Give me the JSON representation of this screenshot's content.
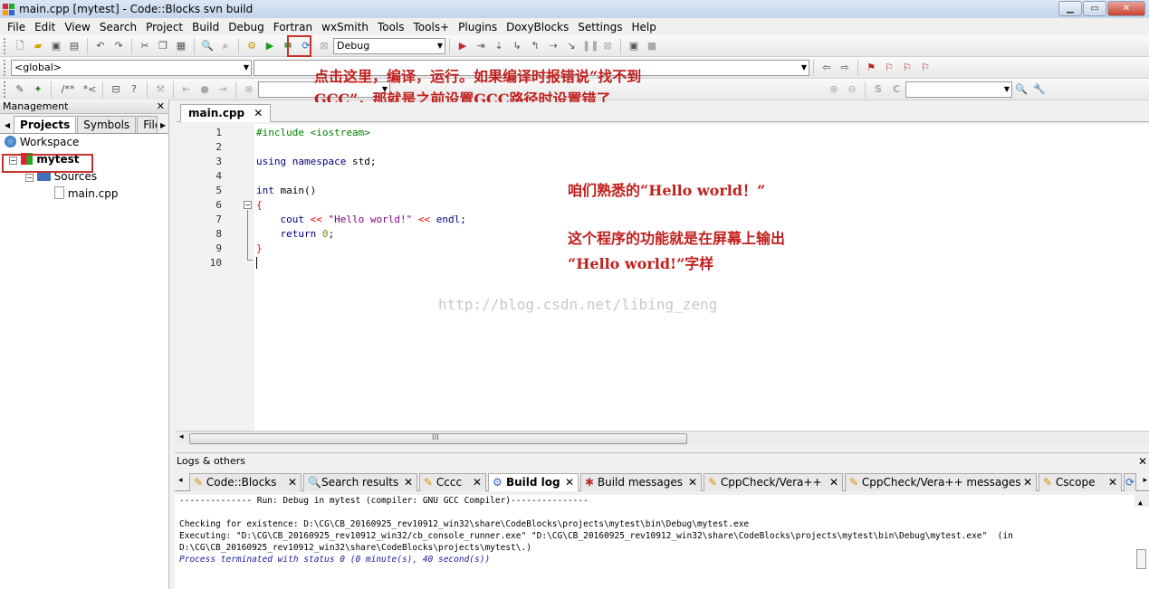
{
  "window": {
    "title": "main.cpp [mytest] - Code::Blocks svn build"
  },
  "menu": [
    "File",
    "Edit",
    "View",
    "Search",
    "Project",
    "Build",
    "Debug",
    "Fortran",
    "wxSmith",
    "Tools",
    "Tools+",
    "Plugins",
    "DoxyBlocks",
    "Settings",
    "Help"
  ],
  "toolbar": {
    "build_target": "Debug",
    "scope_combo": "<global>"
  },
  "annotations": {
    "build_note_line1": "点击这里，编译，运行。如果编译时报错说“找不到",
    "build_note_line2": "GCC”，那就是之前设置GCC路径时设置错了",
    "hello_note": "咱们熟悉的“Hello world！”",
    "program_note_line1": "这个程序的功能就是在屏幕上输出",
    "program_note_line2": "“Hello world!”字样"
  },
  "management": {
    "title": "Management",
    "tabs": [
      "Projects",
      "Symbols",
      "Files"
    ],
    "tree": {
      "workspace": "Workspace",
      "project": "mytest",
      "folder": "Sources",
      "file": "main.cpp"
    }
  },
  "editor": {
    "tab": "main.cpp",
    "line_numbers": [
      "1",
      "2",
      "3",
      "4",
      "5",
      "6",
      "7",
      "8",
      "9",
      "10"
    ],
    "code": {
      "l1": "#include <iostream>",
      "l3_kw": "using namespace",
      "l3_rest": " std;",
      "l5_kw": "int",
      "l5_rest": " main()",
      "l6": "{",
      "l7_a": "    cout ",
      "l7_op1": "<<",
      "l7_str": " \"Hello world!\" ",
      "l7_op2": "<<",
      "l7_end": " endl;",
      "l8_kw": "    return",
      "l8_num": " 0",
      "l8_end": ";",
      "l9": "}"
    },
    "scroll_marker": "III"
  },
  "watermark": "http://blog.csdn.net/libing_zeng",
  "logs": {
    "title": "Logs & others",
    "tabs": [
      "Code::Blocks",
      "Search results",
      "Cccc",
      "Build log",
      "Build messages",
      "CppCheck/Vera++",
      "CppCheck/Vera++ messages",
      "Cscope"
    ],
    "lines": [
      "-------------- Run: Debug in mytest (compiler: GNU GCC Compiler)---------------",
      "",
      "Checking for existence: D:\\CG\\CB_20160925_rev10912_win32\\share\\CodeBlocks\\projects\\mytest\\bin\\Debug\\mytest.exe",
      "Executing: \"D:\\CG\\CB_20160925_rev10912_win32/cb_console_runner.exe\" \"D:\\CG\\CB_20160925_rev10912_win32\\share\\CodeBlocks\\projects\\mytest\\bin\\Debug\\mytest.exe\"  (in",
      "D:\\CG\\CB_20160925_rev10912_win32\\share\\CodeBlocks\\projects\\mytest\\.)"
    ],
    "status_line": "Process terminated with status 0 (0 minute(s), 40 second(s))"
  }
}
